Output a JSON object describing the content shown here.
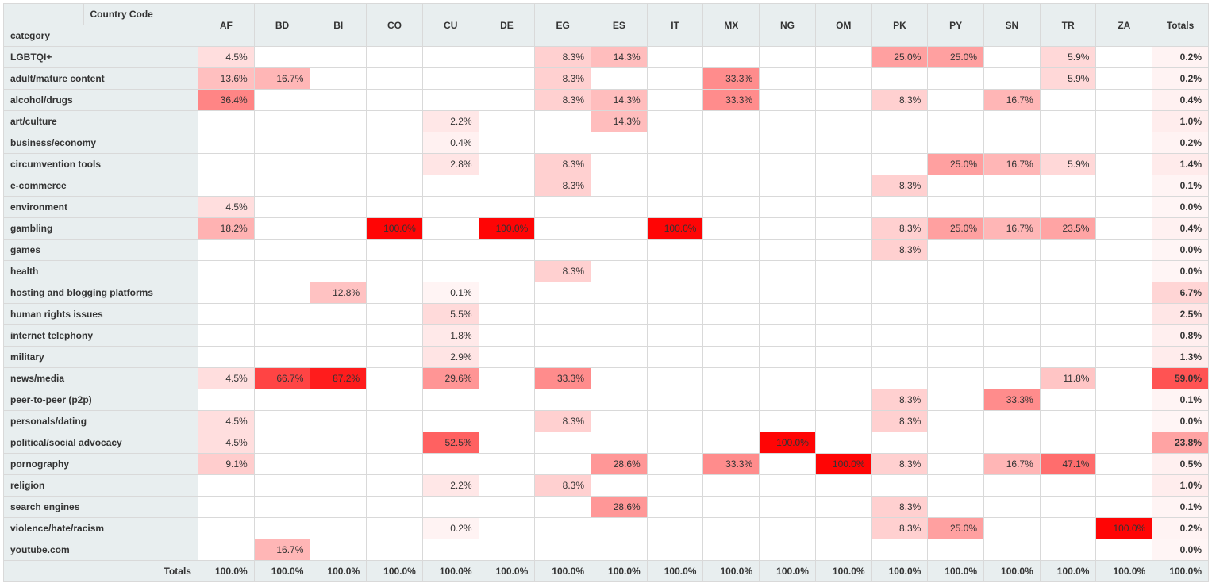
{
  "header": {
    "corner_top": "Country Code",
    "corner_bottom": "category",
    "countries": [
      "AF",
      "BD",
      "BI",
      "CO",
      "CU",
      "DE",
      "EG",
      "ES",
      "IT",
      "MX",
      "NG",
      "OM",
      "PK",
      "PY",
      "SN",
      "TR",
      "ZA"
    ],
    "totals_label": "Totals"
  },
  "categories": [
    "LGBTQI+",
    "adult/mature content",
    "alcohol/drugs",
    "art/culture",
    "business/economy",
    "circumvention tools",
    "e-commerce",
    "environment",
    "gambling",
    "games",
    "health",
    "hosting and blogging platforms",
    "human rights issues",
    "internet telephony",
    "military",
    "news/media",
    "peer-to-peer (p2p)",
    "personals/dating",
    "political/social advocacy",
    "pornography",
    "religion",
    "search engines",
    "violence/hate/racism",
    "youtube.com"
  ],
  "chart_data": {
    "type": "heatmap",
    "title": "",
    "x": [
      "AF",
      "BD",
      "BI",
      "CO",
      "CU",
      "DE",
      "EG",
      "ES",
      "IT",
      "MX",
      "NG",
      "OM",
      "PK",
      "PY",
      "SN",
      "TR",
      "ZA",
      "Totals"
    ],
    "y": [
      "LGBTQI+",
      "adult/mature content",
      "alcohol/drugs",
      "art/culture",
      "business/economy",
      "circumvention tools",
      "e-commerce",
      "environment",
      "gambling",
      "games",
      "health",
      "hosting and blogging platforms",
      "human rights issues",
      "internet telephony",
      "military",
      "news/media",
      "peer-to-peer (p2p)",
      "personals/dating",
      "political/social advocacy",
      "pornography",
      "religion",
      "search engines",
      "violence/hate/racism",
      "youtube.com"
    ],
    "values": [
      [
        4.5,
        null,
        null,
        null,
        null,
        null,
        8.3,
        14.3,
        null,
        null,
        null,
        null,
        25.0,
        25.0,
        null,
        5.9,
        null,
        0.2
      ],
      [
        13.6,
        16.7,
        null,
        null,
        null,
        null,
        8.3,
        null,
        null,
        33.3,
        null,
        null,
        null,
        null,
        null,
        5.9,
        null,
        0.2
      ],
      [
        36.4,
        null,
        null,
        null,
        null,
        null,
        8.3,
        14.3,
        null,
        33.3,
        null,
        null,
        8.3,
        null,
        16.7,
        null,
        null,
        0.4
      ],
      [
        null,
        null,
        null,
        null,
        2.2,
        null,
        null,
        14.3,
        null,
        null,
        null,
        null,
        null,
        null,
        null,
        null,
        null,
        1.0
      ],
      [
        null,
        null,
        null,
        null,
        0.4,
        null,
        null,
        null,
        null,
        null,
        null,
        null,
        null,
        null,
        null,
        null,
        null,
        0.2
      ],
      [
        null,
        null,
        null,
        null,
        2.8,
        null,
        8.3,
        null,
        null,
        null,
        null,
        null,
        null,
        25.0,
        16.7,
        5.9,
        null,
        1.4
      ],
      [
        null,
        null,
        null,
        null,
        null,
        null,
        8.3,
        null,
        null,
        null,
        null,
        null,
        8.3,
        null,
        null,
        null,
        null,
        0.1
      ],
      [
        4.5,
        null,
        null,
        null,
        null,
        null,
        null,
        null,
        null,
        null,
        null,
        null,
        null,
        null,
        null,
        null,
        null,
        0.0
      ],
      [
        18.2,
        null,
        null,
        100.0,
        null,
        100.0,
        null,
        null,
        100.0,
        null,
        null,
        null,
        8.3,
        25.0,
        16.7,
        23.5,
        null,
        0.4
      ],
      [
        null,
        null,
        null,
        null,
        null,
        null,
        null,
        null,
        null,
        null,
        null,
        null,
        8.3,
        null,
        null,
        null,
        null,
        0.0
      ],
      [
        null,
        null,
        null,
        null,
        null,
        null,
        8.3,
        null,
        null,
        null,
        null,
        null,
        null,
        null,
        null,
        null,
        null,
        0.0
      ],
      [
        null,
        null,
        12.8,
        null,
        0.1,
        null,
        null,
        null,
        null,
        null,
        null,
        null,
        null,
        null,
        null,
        null,
        null,
        6.7
      ],
      [
        null,
        null,
        null,
        null,
        5.5,
        null,
        null,
        null,
        null,
        null,
        null,
        null,
        null,
        null,
        null,
        null,
        null,
        2.5
      ],
      [
        null,
        null,
        null,
        null,
        1.8,
        null,
        null,
        null,
        null,
        null,
        null,
        null,
        null,
        null,
        null,
        null,
        null,
        0.8
      ],
      [
        null,
        null,
        null,
        null,
        2.9,
        null,
        null,
        null,
        null,
        null,
        null,
        null,
        null,
        null,
        null,
        null,
        null,
        1.3
      ],
      [
        4.5,
        66.7,
        87.2,
        null,
        29.6,
        null,
        33.3,
        null,
        null,
        null,
        null,
        null,
        null,
        null,
        null,
        11.8,
        null,
        59.0
      ],
      [
        null,
        null,
        null,
        null,
        null,
        null,
        null,
        null,
        null,
        null,
        null,
        null,
        8.3,
        null,
        33.3,
        null,
        null,
        0.1
      ],
      [
        4.5,
        null,
        null,
        null,
        null,
        null,
        8.3,
        null,
        null,
        null,
        null,
        null,
        8.3,
        null,
        null,
        null,
        null,
        0.0
      ],
      [
        4.5,
        null,
        null,
        null,
        52.5,
        null,
        null,
        null,
        null,
        null,
        100.0,
        null,
        null,
        null,
        null,
        null,
        null,
        23.8
      ],
      [
        9.1,
        null,
        null,
        null,
        null,
        null,
        null,
        28.6,
        null,
        33.3,
        null,
        100.0,
        8.3,
        null,
        16.7,
        47.1,
        null,
        0.5
      ],
      [
        null,
        null,
        null,
        null,
        2.2,
        null,
        8.3,
        null,
        null,
        null,
        null,
        null,
        null,
        null,
        null,
        null,
        null,
        1.0
      ],
      [
        null,
        null,
        null,
        null,
        null,
        null,
        null,
        28.6,
        null,
        null,
        null,
        null,
        8.3,
        null,
        null,
        null,
        null,
        0.1
      ],
      [
        null,
        null,
        null,
        null,
        0.2,
        null,
        null,
        null,
        null,
        null,
        null,
        null,
        8.3,
        25.0,
        null,
        null,
        100.0,
        0.2
      ],
      [
        null,
        16.7,
        null,
        null,
        null,
        null,
        null,
        null,
        null,
        null,
        null,
        null,
        null,
        null,
        null,
        null,
        null,
        0.0
      ]
    ],
    "column_totals": [
      100.0,
      100.0,
      100.0,
      100.0,
      100.0,
      100.0,
      100.0,
      100.0,
      100.0,
      100.0,
      100.0,
      100.0,
      100.0,
      100.0,
      100.0,
      100.0,
      100.0,
      100.0
    ]
  },
  "totals_row_label": "Totals"
}
